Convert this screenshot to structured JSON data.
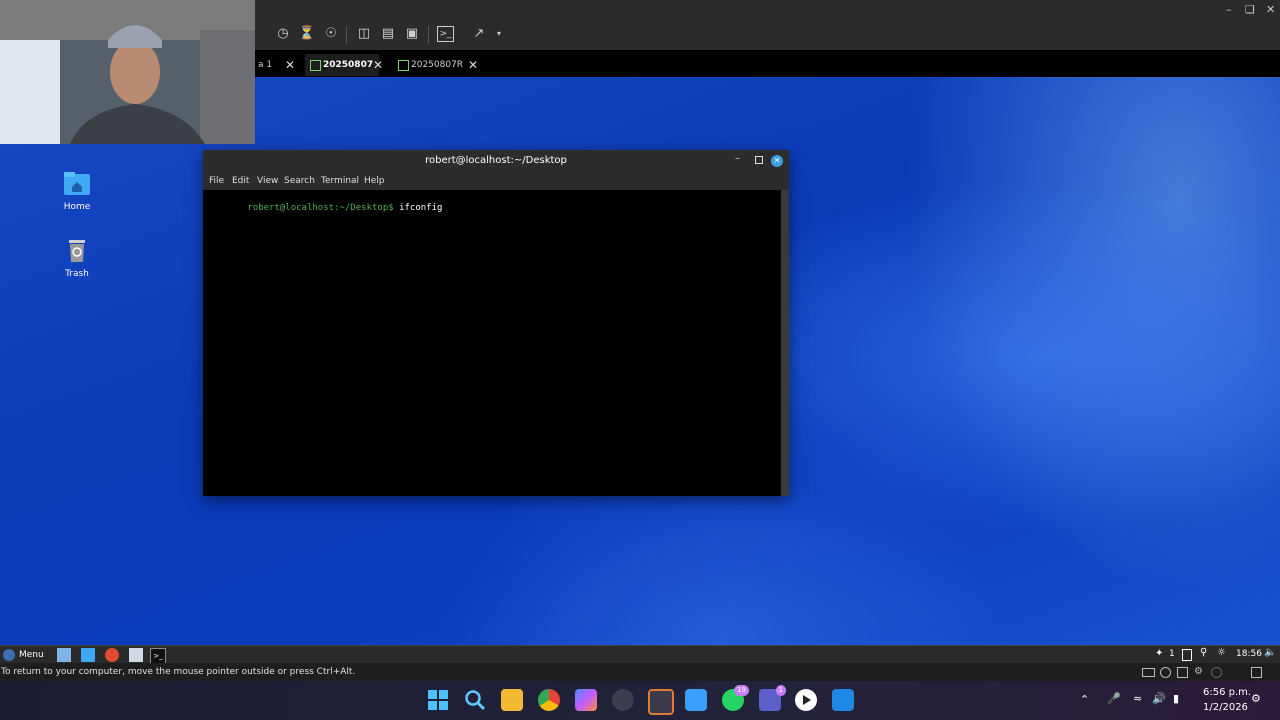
{
  "vm": {
    "tabs": [
      {
        "label": "a 1"
      },
      {
        "label": "20250807",
        "active": true
      },
      {
        "label": "20250807R"
      }
    ],
    "status_text": "To return to your computer, move the mouse pointer outside or press Ctrl+Alt."
  },
  "desktop": {
    "icons": [
      {
        "label": "Home",
        "icon": "home-folder-icon"
      },
      {
        "label": "Trash",
        "icon": "trash-icon"
      }
    ]
  },
  "terminal": {
    "title": "robert@localhost:~/Desktop",
    "menu": [
      "File",
      "Edit",
      "View",
      "Search",
      "Terminal",
      "Help"
    ],
    "prompt": "robert@localhost:~/Desktop$",
    "command": " ifconfig"
  },
  "guest_taskbar": {
    "menu_label": "Menu",
    "workspace": "1",
    "time": "18:56"
  },
  "windows_taskbar": {
    "badges": {
      "whatsapp": "19",
      "teams": "1"
    },
    "time": "6:56 p.m.",
    "date": "1/2/2026"
  },
  "colors": {
    "prompt": "#4caf50",
    "accent": "#0a3bbd"
  }
}
